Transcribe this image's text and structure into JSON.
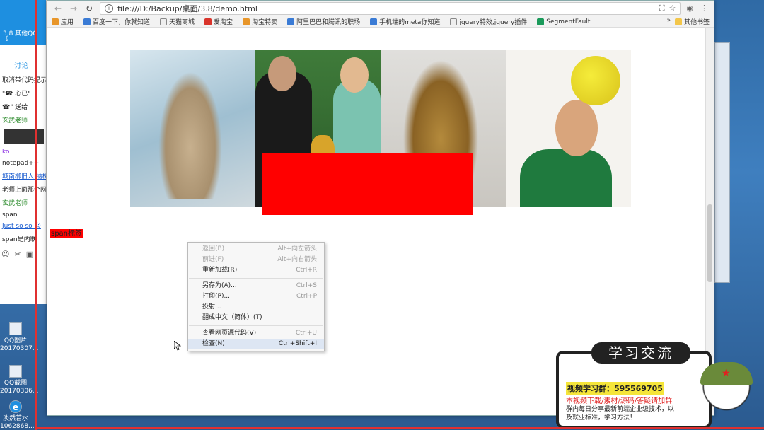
{
  "browser": {
    "url": "file:///D:/Backup/桌面/3.8/demo.html",
    "bookmarks": [
      "应用",
      "百度一下，你就知道",
      "天猫商城",
      "爱淘宝",
      "淘宝特卖",
      "阿里巴巴和腾讯的职场",
      "手机端的meta你知道",
      "jquery特效,jquery插件",
      "SegmentFault"
    ],
    "other_bookmarks": "其他书签"
  },
  "page": {
    "span_label": "span标签"
  },
  "context_menu": {
    "items": [
      {
        "label": "返回(B)",
        "shortcut": "Alt+向左箭头"
      },
      {
        "label": "前进(F)",
        "shortcut": "Alt+向右箭头"
      },
      {
        "label": "重新加载(R)",
        "shortcut": "Ctrl+R"
      },
      {
        "label": "另存为(A)...",
        "shortcut": "Ctrl+S"
      },
      {
        "label": "打印(P)...",
        "shortcut": "Ctrl+P"
      },
      {
        "label": "投射...",
        "shortcut": ""
      },
      {
        "label": "翻成中文（简体）(T)",
        "shortcut": ""
      },
      {
        "label": "查看网页源代码(V)",
        "shortcut": "Ctrl+U"
      },
      {
        "label": "检查(N)",
        "shortcut": "Ctrl+Shift+I"
      }
    ]
  },
  "qq_panel": {
    "window_title": "3.8 其他QQ",
    "tab": "讨论",
    "lines": [
      "取消带代码提示",
      "\"☎ 心已\"",
      "☎\" 送给",
      "玄武老师",
      "ko",
      "notepad++",
      "城南柳旧人·纳桃",
      "老师上面那个网",
      "玄武老师",
      "span",
      "Just so so ☺",
      "span是内联"
    ]
  },
  "desktop_icons": [
    {
      "label1": "QQ图片",
      "label2": "20170307..."
    },
    {
      "label1": "QQ截图",
      "label2": "20170306..."
    },
    {
      "label1": "淡然若水",
      "label2": "1062868..."
    }
  ],
  "ad": {
    "title": "学习交流",
    "group": "视频学习群：595569705",
    "line2": "本视频下载/素材/源码/答疑请加群",
    "line3": "群内每日分享最新前端企业级技术，以及就业标准，学习方法！"
  }
}
